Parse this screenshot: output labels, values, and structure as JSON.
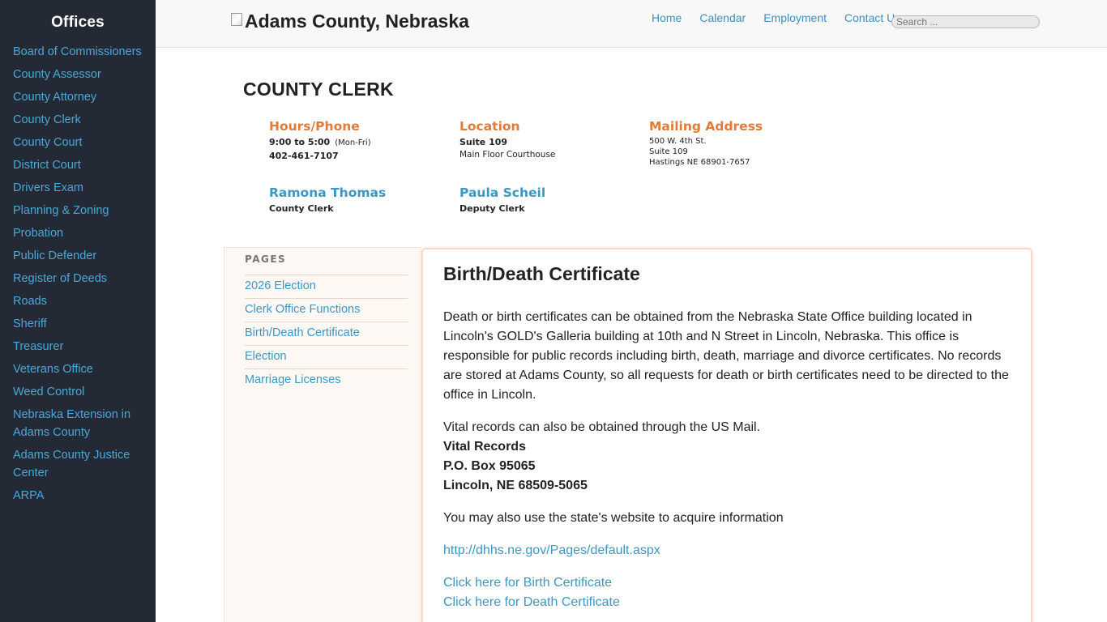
{
  "sidebar": {
    "title": "Offices",
    "items": [
      {
        "label": "Board of Commissioners"
      },
      {
        "label": "County Assessor"
      },
      {
        "label": "County Attorney"
      },
      {
        "label": "County Clerk"
      },
      {
        "label": "County Court"
      },
      {
        "label": "District Court"
      },
      {
        "label": "Drivers Exam"
      },
      {
        "label": "Planning & Zoning"
      },
      {
        "label": "Probation"
      },
      {
        "label": "Public Defender"
      },
      {
        "label": "Register of Deeds"
      },
      {
        "label": "Roads"
      },
      {
        "label": "Sheriff"
      },
      {
        "label": "Treasurer"
      },
      {
        "label": "Veterans Office"
      },
      {
        "label": "Weed Control"
      },
      {
        "label": "Nebraska Extension in Adams County"
      },
      {
        "label": "Adams County Justice Center"
      },
      {
        "label": "ARPA"
      }
    ]
  },
  "header": {
    "site_title": "Adams County, Nebraska",
    "nav": [
      {
        "label": "Home"
      },
      {
        "label": "Calendar"
      },
      {
        "label": "Employment"
      },
      {
        "label": "Contact Us"
      }
    ],
    "search_placeholder": "Search ..."
  },
  "department": {
    "title": "COUNTY CLERK",
    "hours": {
      "heading": "Hours/Phone",
      "time": "9:00 to 5:00",
      "days": "(Mon-Fri)",
      "phone": "402-461-7107"
    },
    "location": {
      "heading": "Location",
      "line1": "Suite 109",
      "line2": "Main Floor Courthouse"
    },
    "mailing": {
      "heading": "Mailing Address",
      "line1": "500 W. 4th St.",
      "line2": "Suite 109",
      "line3": "Hastings NE 68901-7657"
    },
    "staff": [
      {
        "name": "Ramona Thomas",
        "role": "County Clerk"
      },
      {
        "name": "Paula Scheil",
        "role": "Deputy Clerk"
      }
    ]
  },
  "pages": {
    "title": "PAGES",
    "items": [
      {
        "label": "2026 Election"
      },
      {
        "label": "Clerk Office Functions"
      },
      {
        "label": "Birth/Death Certificate"
      },
      {
        "label": "Election"
      },
      {
        "label": "Marriage Licenses"
      }
    ]
  },
  "content": {
    "title": "Birth/Death Certificate",
    "para1": "Death or birth certificates can be obtained from the Nebraska State Office building located in Lincoln's GOLD's Galleria building at 10th and N Street in Lincoln, Nebraska. This office is responsible for public records including birth, death, marriage and divorce certificates. No records are stored at Adams County, so all requests for death or birth certificates need to be directed to the office in Lincoln.",
    "para2": "Vital records can also be obtained through the US Mail.",
    "address_name": "Vital Records",
    "address_box": "P.O. Box 95065",
    "address_city": "Lincoln, NE 68509-5065",
    "para3": "You may also use the state's website to acquire information",
    "dhhs_link": "http://dhhs.ne.gov/Pages/default.aspx",
    "birth_link": "Click here for Birth Certificate",
    "death_link": "Click here for Death Certificate"
  }
}
